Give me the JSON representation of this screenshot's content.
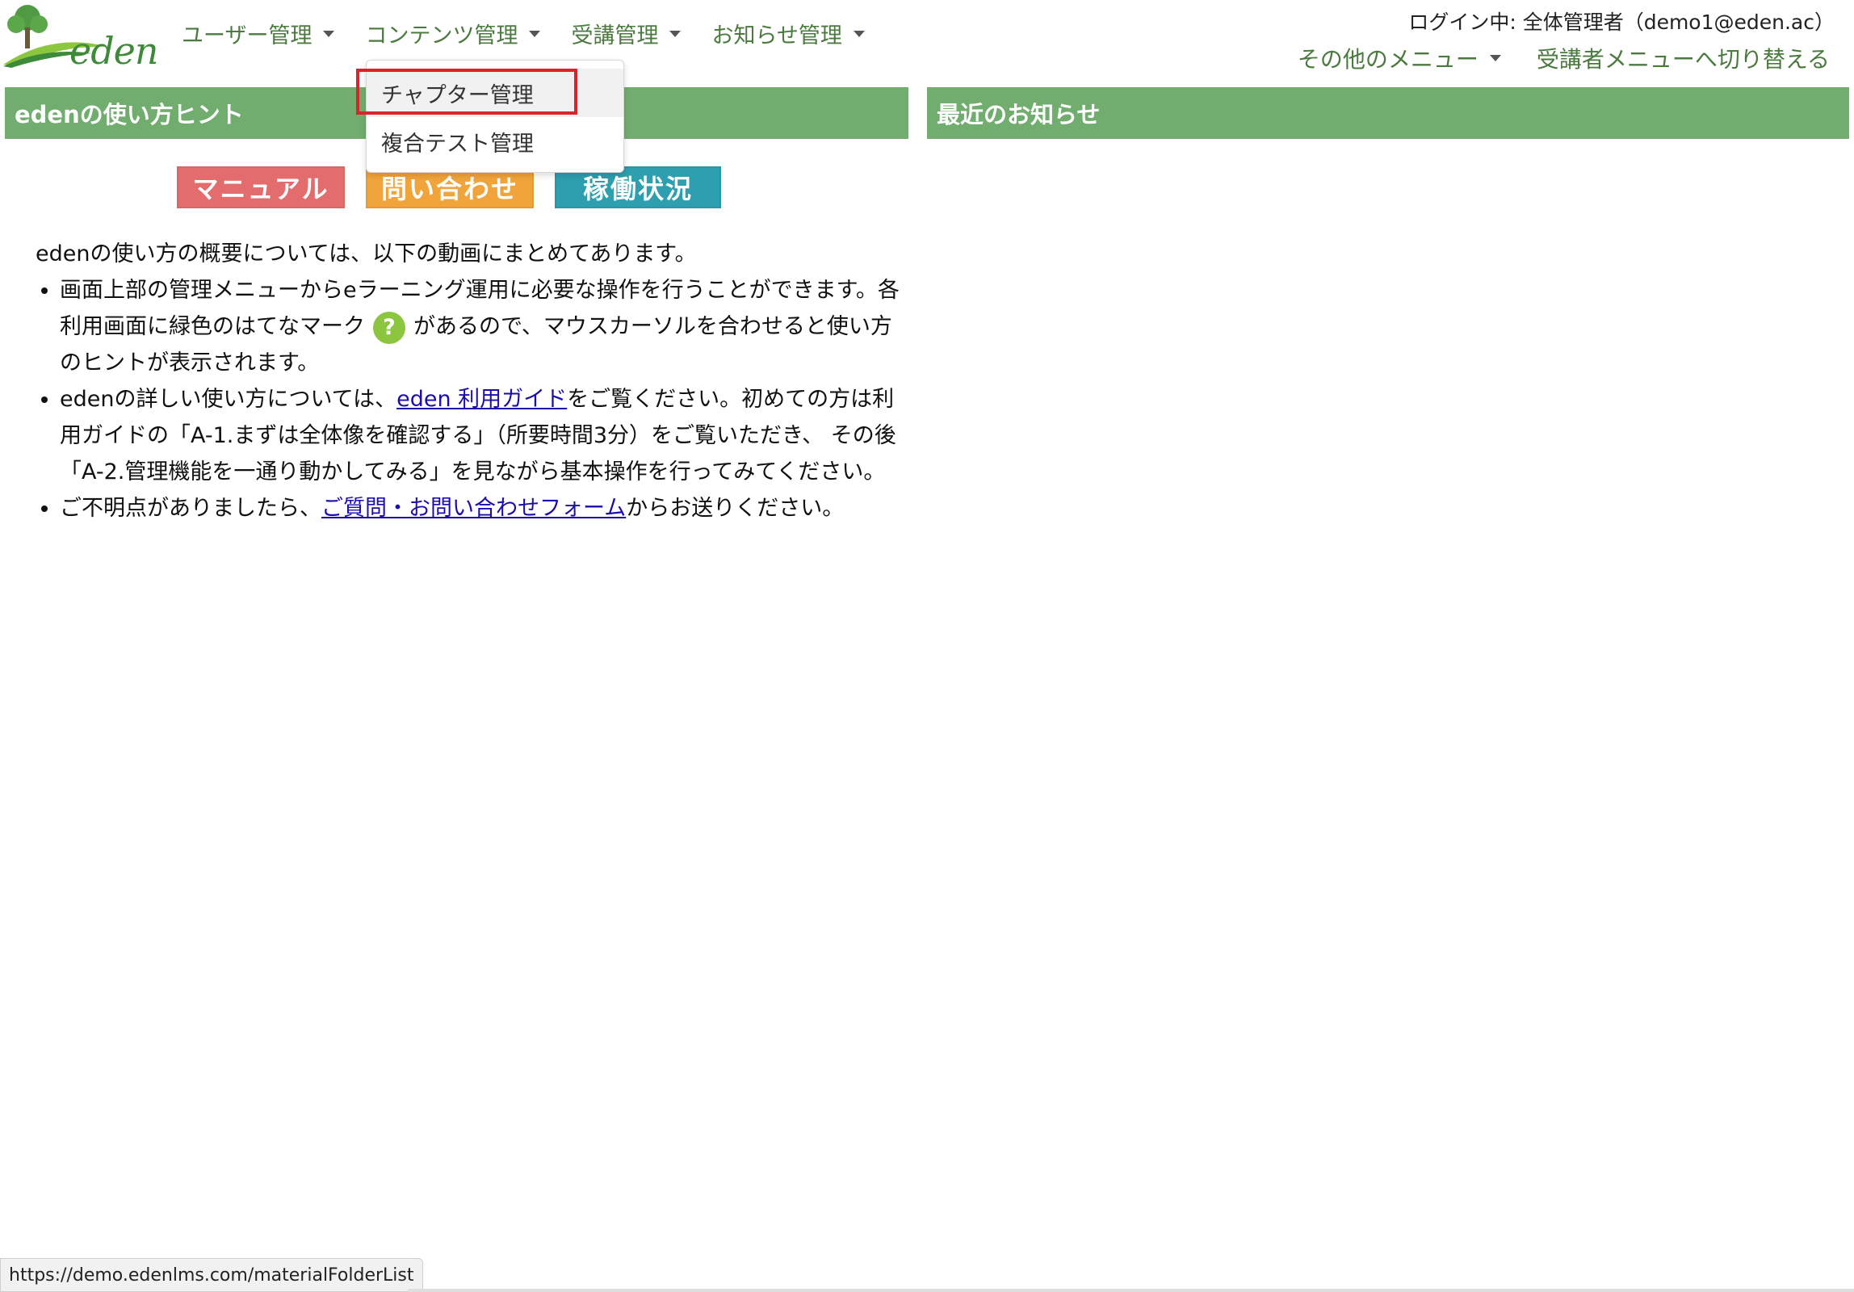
{
  "logo": {
    "text": "eden"
  },
  "nav": {
    "items": [
      {
        "label": "ユーザー管理"
      },
      {
        "label": "コンテンツ管理"
      },
      {
        "label": "受講管理"
      },
      {
        "label": "お知らせ管理"
      }
    ]
  },
  "login_info": "ログイン中: 全体管理者（demo1@eden.ac）",
  "right_menu": {
    "other_menu": "その他のメニュー",
    "switch_menu": "受講者メニューへ切り替える"
  },
  "dropdown": {
    "items": [
      {
        "label": "チャプター管理"
      },
      {
        "label": "複合テスト管理"
      }
    ]
  },
  "left_panel": {
    "title": "edenの使い方ヒント",
    "buttons": {
      "manual": "マニュアル",
      "contact": "問い合わせ",
      "status": "稼働状況"
    },
    "intro": "edenの使い方の概要については、以下の動画にまとめてあります。",
    "bullets": {
      "b1_part1": "画面上部の管理メニューからeラーニング運用に必要な操作を行うことができます。各利用画面に緑色のはてなマーク",
      "b1_icon": "?",
      "b1_part2": "があるので、マウスカーソルを合わせると使い方のヒントが表示されます。",
      "b2_part1": "edenの詳しい使い方については、",
      "b2_link": "eden 利用ガイド",
      "b2_part2": "をご覧ください。初めての方は利用ガイドの「A-1.まずは全体像を確認する」（所要時間3分）をご覧いただき、 その後「A-2.管理機能を一通り動かしてみる」を見ながら基本操作を行ってみてください。",
      "b3_part1": "ご不明点がありましたら、",
      "b3_link": "ご質問・お問い合わせフォーム",
      "b3_part2": "からお送りください。"
    }
  },
  "right_panel": {
    "title": "最近のお知らせ"
  },
  "status_url": "https://demo.edenlms.com/materialFolderList",
  "colors": {
    "header_green": "#71ad6e",
    "nav_text": "#4b7a3e",
    "highlight_red": "#d9232d",
    "link_blue": "#1a0dab"
  }
}
